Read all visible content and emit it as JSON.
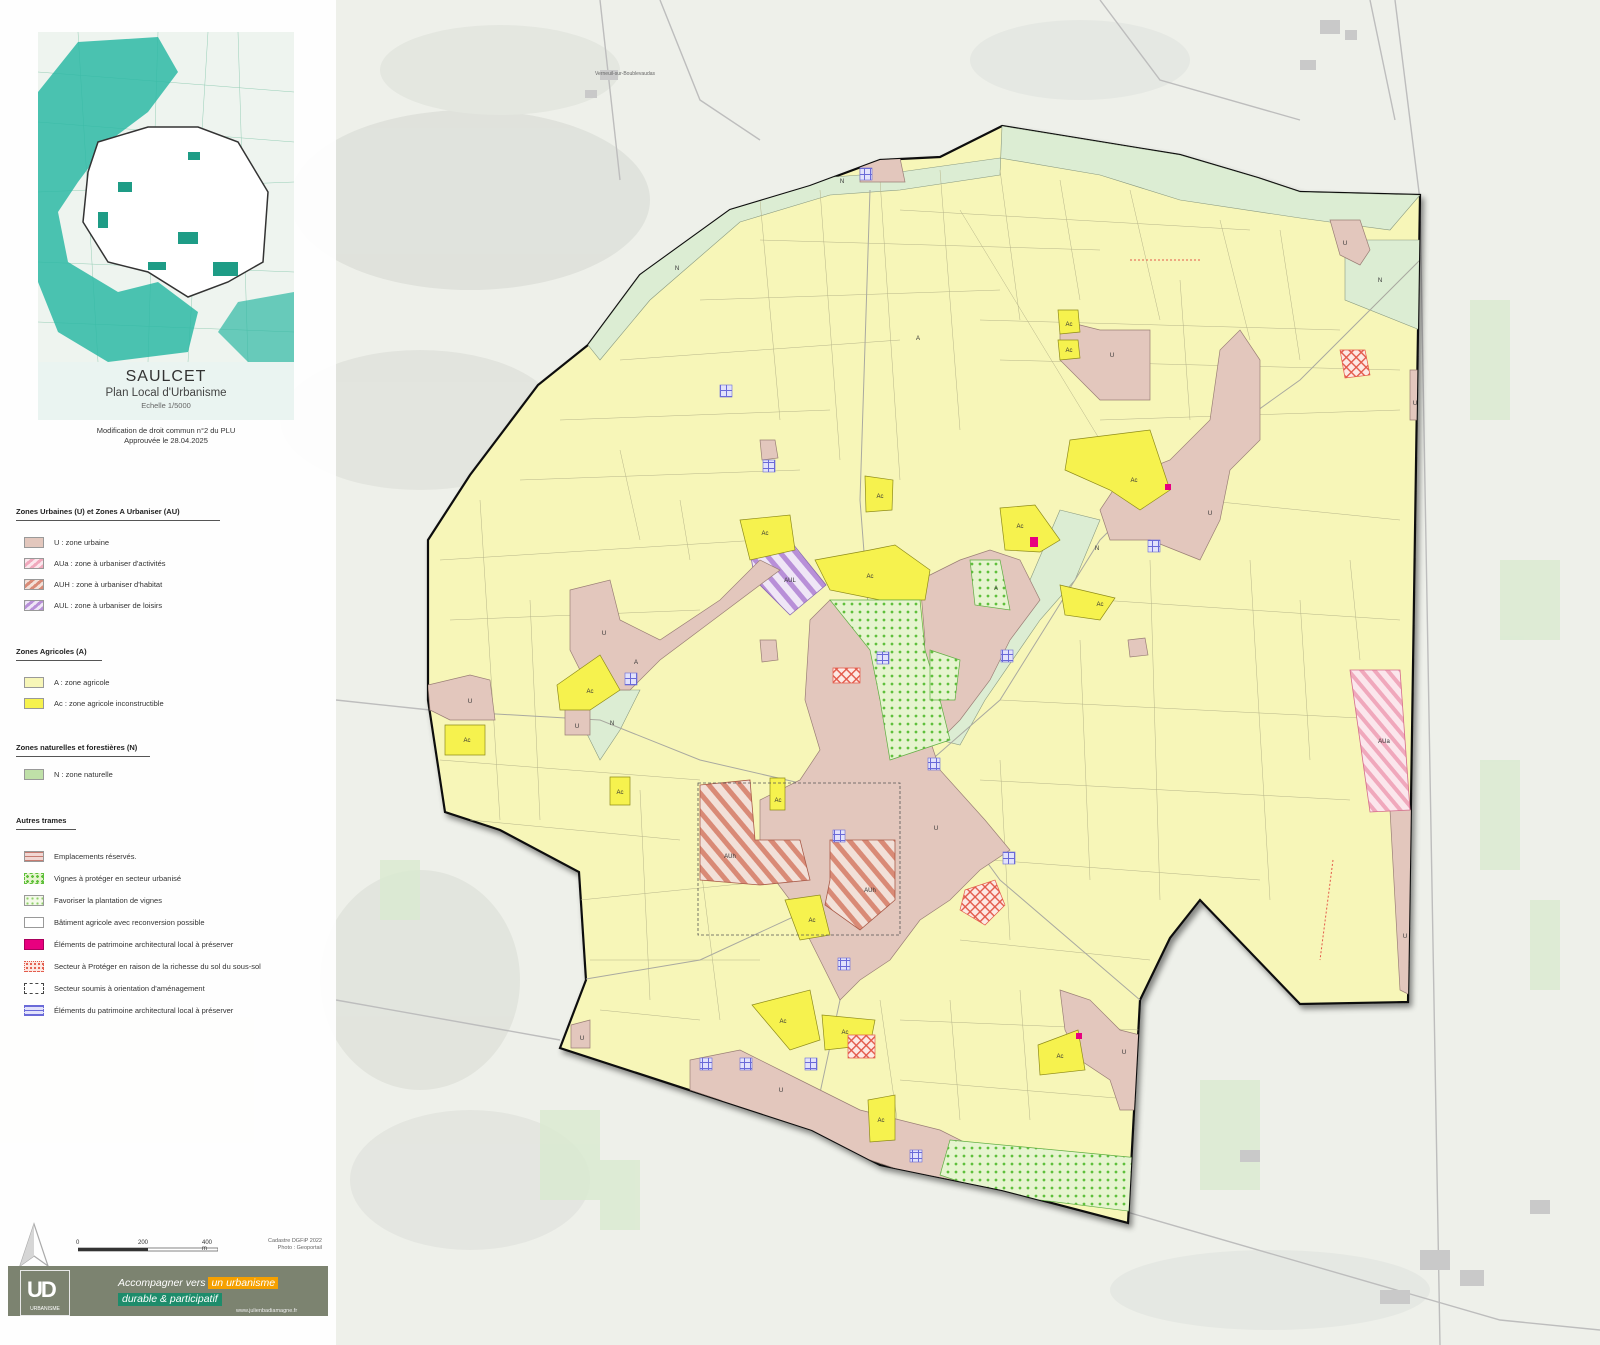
{
  "title": {
    "commune": "SAULCET",
    "document": "Plan Local d'Urbanisme",
    "scale": "Echelle 1/5000",
    "modification_line1": "Modification de droit commun n°2 du PLU",
    "modification_line2": "Approuvée le 28.04.2025"
  },
  "legend": {
    "urban_heading": "Zones Urbaines (U) et Zones A Urbaniser (AU)",
    "u": "U : zone urbaine",
    "aua": "AUa : zone à urbaniser d'activités",
    "auh": "AUH : zone à urbaniser d'habitat",
    "aul": "AUL : zone à urbaniser de loisirs",
    "agri_heading": "Zones Agricoles (A)",
    "a": "A : zone agricole",
    "ac": "Ac : zone agricole inconstructible",
    "nat_heading": "Zones naturelles et forestières (N)",
    "n": "N : zone naturelle",
    "other_heading": "Autres trames",
    "er": "Emplacements réservés.",
    "vignes": "Vignes à protéger en secteur urbanisé",
    "plantation": "Favoriser la plantation de vignes",
    "batiment": "Bâtiment agricole avec reconversion possible",
    "patrimoine1": "Éléments de patrimoine architectural local à préserver",
    "sol": "Secteur à Protéger en raison de la richesse du sol du sous-sol",
    "oap": "Secteur soumis à orientation d'aménagement",
    "patrimoine2": "Éléments du patrimoine architectural local à préserver"
  },
  "colors": {
    "U": "#e3c7bd",
    "A": "#f7f6b8",
    "Ac": "#f6f24e",
    "N": "#dcedd3",
    "AUa": "#f4bccb",
    "AUh": "#e5a190",
    "AUL": "#c8a8e0",
    "patrimoine": "#e8007f",
    "vignes": "#7fd25a",
    "sol": "#e35a4a",
    "outline": "#111111"
  },
  "scalebar": {
    "t0": "0",
    "t1": "200",
    "t2": "400 m"
  },
  "credits": {
    "line1": "Cadastre DGFiP 2022",
    "line2": "Photo : Geoportail"
  },
  "footer": {
    "logo": "UD",
    "logo_small": "URBANISME",
    "slogan_a": "Accompagner vers ",
    "slogan_b": "un urbanisme",
    "slogan_c": "durable & participatif",
    "website": "www.julienbadiamagne.fr"
  },
  "map": {
    "zone_labels": {
      "A": "A",
      "U": "U",
      "N": "N",
      "Ac": "Ac",
      "AUh": "AUh",
      "AUL": "AUL",
      "AUa": "AUa"
    },
    "place_label": "Verneuil-sur-Boublevaudas"
  }
}
